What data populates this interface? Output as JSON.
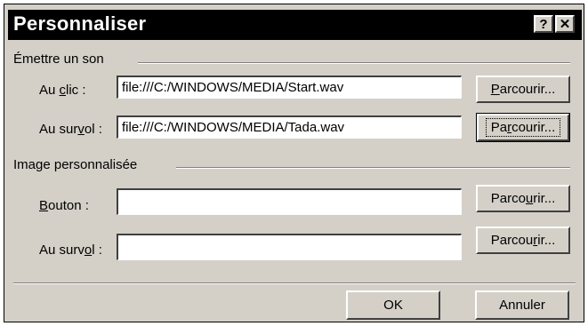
{
  "dialog": {
    "title": "Personnaliser",
    "help_icon": "?",
    "close_icon": "✕"
  },
  "sound_group": {
    "label": "Émettre un son",
    "click": {
      "label_pre": "Au ",
      "label_u": "c",
      "label_post": "lic :",
      "value": "file:///C:/WINDOWS/MEDIA/Start.wav",
      "button_pre": "",
      "button_u": "P",
      "button_post": "arcourir..."
    },
    "hover": {
      "label_pre": "Au sur",
      "label_u": "v",
      "label_post": "ol :",
      "value": "file:///C:/WINDOWS/MEDIA/Tada.wav",
      "button_pre": "Pa",
      "button_u": "r",
      "button_post": "courir..."
    }
  },
  "image_group": {
    "label": "Image personnalisée",
    "button": {
      "label_pre": "",
      "label_u": "B",
      "label_post": "outon :",
      "value": "",
      "button_pre": "Parco",
      "button_u": "u",
      "button_post": "rir..."
    },
    "hover": {
      "label_pre": "Au surv",
      "label_u": "o",
      "label_post": "l :",
      "value": "",
      "button_pre": "Parcou",
      "button_u": "r",
      "button_post": "ir..."
    }
  },
  "footer": {
    "ok_label": "OK",
    "cancel_label": "Annuler"
  }
}
